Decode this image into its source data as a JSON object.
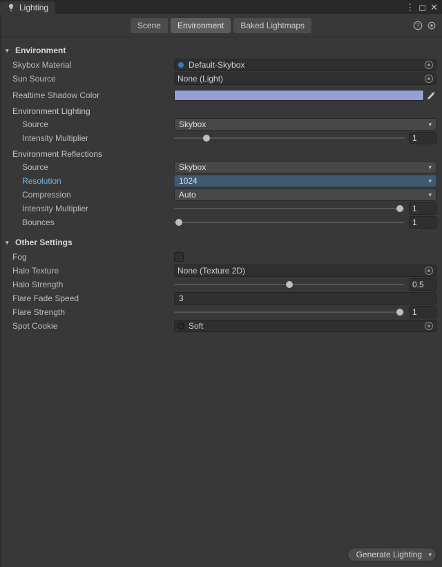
{
  "titlebar": {
    "title": "Lighting"
  },
  "tabs": [
    "Scene",
    "Environment",
    "Baked Lightmaps"
  ],
  "sections": {
    "environment": {
      "title": "Environment",
      "skyboxMaterial": {
        "label": "Skybox Material",
        "value": "Default-Skybox"
      },
      "sunSource": {
        "label": "Sun Source",
        "value": "None (Light)"
      },
      "realtimeShadowColor": {
        "label": "Realtime Shadow Color",
        "value": "#97a0d4"
      },
      "lighting": {
        "title": "Environment Lighting",
        "source": {
          "label": "Source",
          "value": "Skybox"
        },
        "intensity": {
          "label": "Intensity Multiplier",
          "value": "1"
        }
      },
      "reflections": {
        "title": "Environment Reflections",
        "source": {
          "label": "Source",
          "value": "Skybox"
        },
        "resolution": {
          "label": "Resolution",
          "value": "1024"
        },
        "compression": {
          "label": "Compression",
          "value": "Auto"
        },
        "intensity": {
          "label": "Intensity Multiplier",
          "value": "1"
        },
        "bounces": {
          "label": "Bounces",
          "value": "1"
        }
      }
    },
    "other": {
      "title": "Other Settings",
      "fog": {
        "label": "Fog",
        "checked": false
      },
      "haloTexture": {
        "label": "Halo Texture",
        "value": "None (Texture 2D)"
      },
      "haloStrength": {
        "label": "Halo Strength",
        "value": "0.5"
      },
      "flareFadeSpeed": {
        "label": "Flare Fade Speed",
        "value": "3"
      },
      "flareStrength": {
        "label": "Flare Strength",
        "value": "1"
      },
      "spotCookie": {
        "label": "Spot Cookie",
        "value": "Soft"
      }
    }
  },
  "footer": {
    "generate": "Generate Lighting"
  },
  "colors": {
    "shadow": "#97a0d4",
    "highlight": "#6fb7e6"
  }
}
